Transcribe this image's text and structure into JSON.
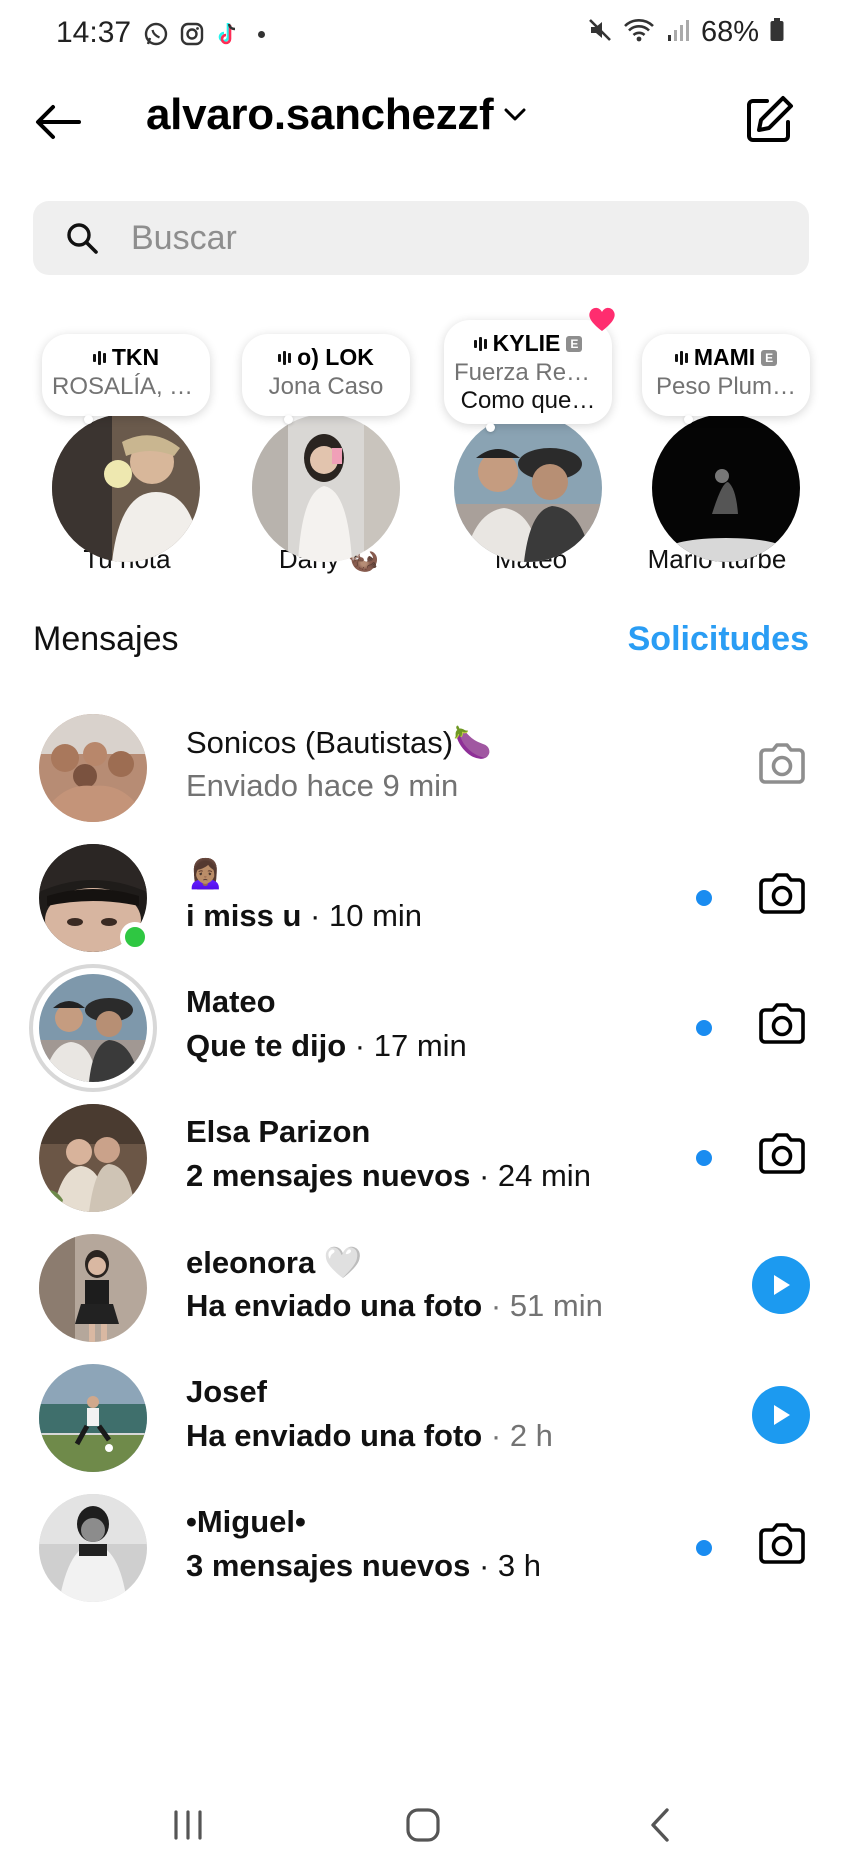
{
  "status_bar": {
    "time": "14:37",
    "battery": "68%",
    "app_icons": [
      "whatsapp-icon",
      "instagram-icon",
      "tiktok-icon"
    ],
    "system_icons": [
      "mute-icon",
      "wifi-icon",
      "signal-icon",
      "battery-icon"
    ]
  },
  "header": {
    "account_name": "alvaro.sanchezzf"
  },
  "search": {
    "placeholder": "Buscar"
  },
  "notes": [
    {
      "label": "Tu nota",
      "song": "TKN",
      "artist": "ROSALÍA, T…",
      "explicit": false,
      "liked": false
    },
    {
      "label": "Dany 🦦",
      "song": "o)      LOK",
      "artist": "Jona Caso",
      "explicit": false,
      "liked": false
    },
    {
      "label": "Mateo",
      "song": "KYLIE",
      "artist": "Fuerza Reg…",
      "extra": "Como que…",
      "explicit": true,
      "liked": true
    },
    {
      "label": "Mario Iturbe",
      "song": "MAMI",
      "artist": "Peso Plum…",
      "explicit": true,
      "liked": false
    }
  ],
  "section": {
    "title": "Mensajes",
    "requests": "Solicitudes"
  },
  "conversations": [
    {
      "name": "Sonicos (Bautistas)🍆",
      "message": "Enviado hace 9 min",
      "time": "",
      "unread": false,
      "action": "camera"
    },
    {
      "name": "🙍🏽‍♀️",
      "message": "i miss u",
      "time": "10 min",
      "unread": true,
      "online": true,
      "action": "camera"
    },
    {
      "name": "Mateo",
      "message": "Que te dijo",
      "time": "17 min",
      "unread": true,
      "story_ring": true,
      "action": "camera"
    },
    {
      "name": "Elsa Parizon",
      "message": "2 mensajes nuevos",
      "time": "24 min",
      "unread": true,
      "action": "camera"
    },
    {
      "name": "eleonora 🤍",
      "message": "Ha enviado una foto",
      "time": "51 min",
      "unread": false,
      "action": "play"
    },
    {
      "name": "Josef",
      "message": "Ha enviado una foto",
      "time": "2 h",
      "unread": false,
      "action": "play"
    },
    {
      "name": "•Miguel•",
      "message": "3 mensajes nuevos",
      "time": "3 h",
      "unread": true,
      "action": "camera"
    }
  ],
  "colors": {
    "accent": "#2a9df4",
    "unread_dot": "#1a8cf0",
    "online": "#2fc742",
    "heart": "#ff2d6f"
  }
}
